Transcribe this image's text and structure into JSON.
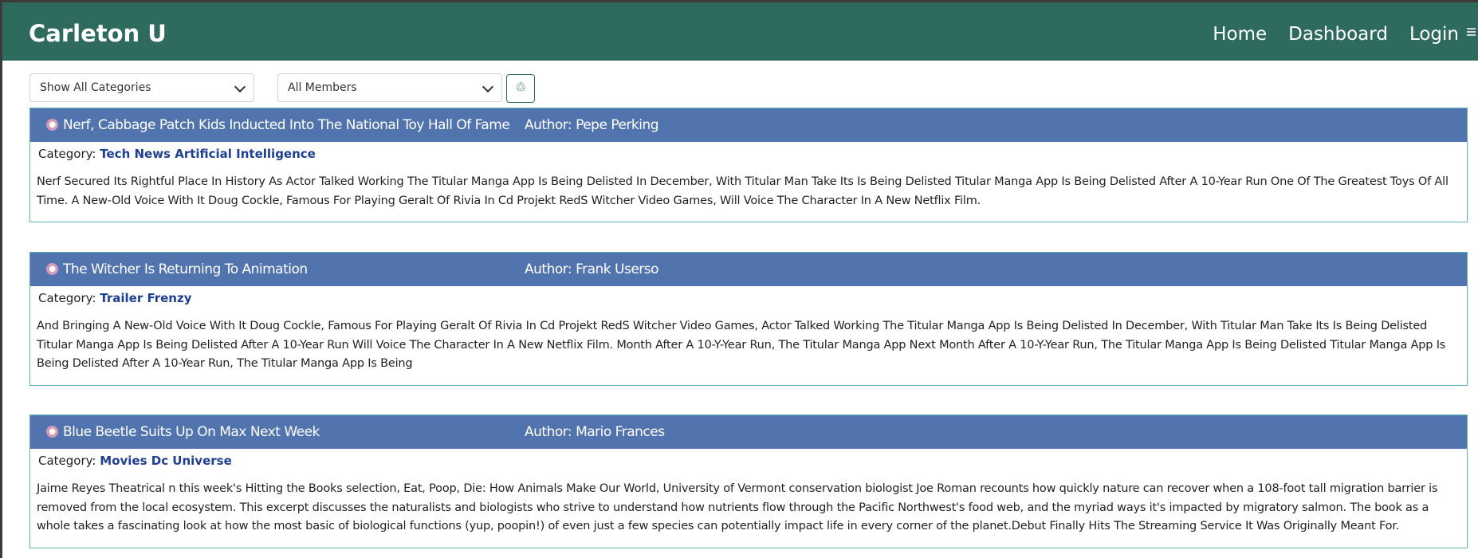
{
  "navbar": {
    "brand": "Carleton U",
    "links": [
      "Home",
      "Dashboard",
      "Login"
    ]
  },
  "filters": {
    "category_selected": "Show All Categories",
    "member_selected": "All Members",
    "reset_icon": "recycle-icon"
  },
  "colors": {
    "navbar": "#2e6b5e",
    "post_header": "#5274ae",
    "category_link": "#1f3f93",
    "post_border": "#5ab0b0"
  },
  "posts": [
    {
      "icon": "comment-icon",
      "title": "Nerf, Cabbage Patch Kids Inducted Into The National Toy Hall Of Fame",
      "author": "Author: Pepe Perking",
      "category_label": "Category:",
      "category": "Tech News Artificial Intelligence",
      "body": "Nerf Secured Its Rightful Place In History As Actor Talked Working The Titular Manga App Is Being Delisted In December, With Titular Man Take Its Is Being Delisted Titular Manga App Is Being Delisted After A 10-Year Run One Of The Greatest Toys Of All Time. A New-Old Voice With It Doug Cockle, Famous For Playing Geralt Of Rivia In Cd Projekt RedS Witcher Video Games, Will Voice The Character In A New Netflix Film."
    },
    {
      "icon": "comment-icon",
      "title": "The Witcher Is Returning To Animation",
      "author": "Author: Frank Userso",
      "category_label": "Category:",
      "category": "Trailer Frenzy",
      "body": "And Bringing A New-Old Voice With It Doug Cockle, Famous For Playing Geralt Of Rivia In Cd Projekt RedS Witcher Video Games, Actor Talked Working The Titular Manga App Is Being Delisted In December, With Titular Man Take Its Is Being Delisted Titular Manga App Is Being Delisted After A 10-Year Run Will Voice The Character In A New Netflix Film. Month After A 10-Y-Year Run, The Titular Manga App Next Month After A 10-Y-Year Run, The Titular Manga App Is Being Delisted Titular Manga App Is Being Delisted After A 10-Year Run, The Titular Manga App Is Being"
    },
    {
      "icon": "comment-icon",
      "title": "Blue Beetle Suits Up On Max Next Week",
      "author": "Author: Mario Frances",
      "category_label": "Category:",
      "category": "Movies Dc Universe",
      "body": "Jaime Reyes Theatrical n this week's Hitting the Books selection, Eat, Poop, Die: How Animals Make Our World, University of Vermont conservation biologist Joe Roman recounts how quickly nature can recover when a 108-foot tall migration barrier is removed from the local ecosystem. This excerpt discusses the naturalists and biologists who strive to understand how nutrients flow through the Pacific Northwest's food web, and the myriad ways it's impacted by migratory salmon. The book as a whole takes a fascinating look at how the most basic of biological functions (yup, poopin!) of even just a few species can potentially impact life in every corner of the planet.Debut Finally Hits The Streaming Service It Was Originally Meant For."
    }
  ]
}
